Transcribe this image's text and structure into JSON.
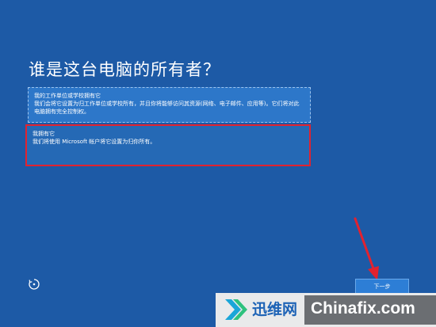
{
  "page": {
    "title": "谁是这台电脑的所有者？"
  },
  "options": {
    "work": {
      "title": "我的工作单位或学校拥有它",
      "description": "我们会将它设置为归工作单位或学校所有，并且你将能够访问其资源(网络、电子邮件、应用等)。它们将对此电脑拥有完全控制权。"
    },
    "own": {
      "title": "我拥有它",
      "description": "我们将使用 Microsoft 帐户将它设置为归你所有。"
    }
  },
  "footer": {
    "ease_of_access_icon": "ease-of-access-icon",
    "next_label": "下一步"
  },
  "annotation": {
    "arrow_color": "#e2222f",
    "highlight_color": "#e2222f"
  },
  "watermark": {
    "site_cn": "迅维网",
    "site_en": "Chinafix.com"
  },
  "colors": {
    "background": "#1d5aa6",
    "option_fill": "#2d77c9",
    "button_fill": "#2d7ed6"
  }
}
